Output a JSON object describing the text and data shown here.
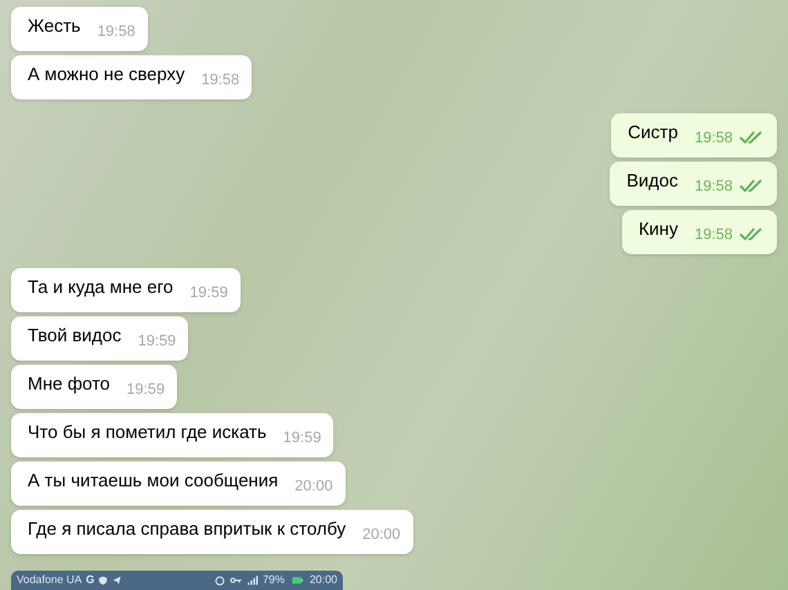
{
  "messages": [
    {
      "text": "Жесть",
      "time": "19:58",
      "outgoing": false,
      "read": false
    },
    {
      "text": "А можно не сверху",
      "time": "19:58",
      "outgoing": false,
      "read": false
    },
    {
      "text": "Систр",
      "time": "19:58",
      "outgoing": true,
      "read": true
    },
    {
      "text": "Видос",
      "time": "19:58",
      "outgoing": true,
      "read": true
    },
    {
      "text": "Кину",
      "time": "19:58",
      "outgoing": true,
      "read": true
    },
    {
      "text": "Та и куда мне его",
      "time": "19:59",
      "outgoing": false,
      "read": false
    },
    {
      "text": "Твой видос",
      "time": "19:59",
      "outgoing": false,
      "read": false
    },
    {
      "text": "Мне фото",
      "time": "19:59",
      "outgoing": false,
      "read": false
    },
    {
      "text": "Что бы я пометил где искать",
      "time": "19:59",
      "outgoing": false,
      "read": false
    },
    {
      "text": "А ты читаешь мои сообщения",
      "time": "20:00",
      "outgoing": false,
      "read": false
    },
    {
      "text": "Где я писала справа впритык к столбу",
      "time": "20:00",
      "outgoing": false,
      "read": false
    }
  ],
  "status_bar": {
    "carrier": "Vodafone UA",
    "carrier_badge": "G",
    "battery": "79%",
    "time": "20:00"
  }
}
